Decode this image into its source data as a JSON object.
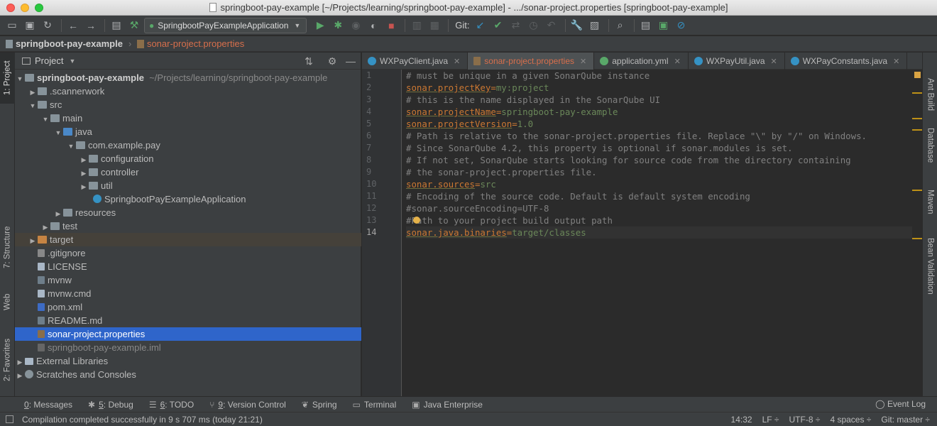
{
  "window": {
    "title": "springboot-pay-example [~/Projects/learning/springboot-pay-example] - .../sonar-project.properties [springboot-pay-example]"
  },
  "toolbar": {
    "run_config": "SpringbootPayExampleApplication",
    "git_label": "Git:"
  },
  "breadcrumb": {
    "root": "springboot-pay-example",
    "file": "sonar-project.properties"
  },
  "left_stripe": {
    "project_tab": "1: Project",
    "structure_tab": "7: Structure",
    "web_tab": "Web",
    "favorites_tab": "2: Favorites"
  },
  "right_stripe": {
    "ant": "Ant Build",
    "database": "Database",
    "maven": "Maven",
    "bean": "Bean Validation"
  },
  "project_panel": {
    "title": "Project",
    "tree": [
      {
        "label": "springboot-pay-example",
        "extra": "~/Projects/learning/springboot-pay-example"
      },
      {
        "label": ".scannerwork"
      },
      {
        "label": "src"
      },
      {
        "label": "main"
      },
      {
        "label": "java"
      },
      {
        "label": "com.example.pay"
      },
      {
        "label": "configuration"
      },
      {
        "label": "controller"
      },
      {
        "label": "util"
      },
      {
        "label": "SpringbootPayExampleApplication"
      },
      {
        "label": "resources"
      },
      {
        "label": "test"
      },
      {
        "label": "target"
      },
      {
        "label": ".gitignore"
      },
      {
        "label": "LICENSE"
      },
      {
        "label": "mvnw"
      },
      {
        "label": "mvnw.cmd"
      },
      {
        "label": "pom.xml"
      },
      {
        "label": "README.md"
      },
      {
        "label": "sonar-project.properties"
      },
      {
        "label": "springboot-pay-example.iml"
      },
      {
        "label": "External Libraries"
      },
      {
        "label": "Scratches and Consoles"
      }
    ]
  },
  "tabs": [
    {
      "label": "WXPayClient.java"
    },
    {
      "label": "sonar-project.properties"
    },
    {
      "label": "application.yml"
    },
    {
      "label": "WXPayUtil.java"
    },
    {
      "label": "WXPayConstants.java"
    }
  ],
  "editor": {
    "line_numbers": [
      "1",
      "2",
      "3",
      "4",
      "5",
      "6",
      "7",
      "8",
      "9",
      "10",
      "11",
      "12",
      "13",
      "14"
    ],
    "lines": [
      {
        "comment": "# must be unique in a given SonarQube instance"
      },
      {
        "key": "sonar.projectKey",
        "eq": "=",
        "value": "my:project"
      },
      {
        "comment": "# this is the name displayed in the SonarQube UI"
      },
      {
        "key": "sonar.projectName",
        "eq": "=",
        "value": "springboot-pay-example"
      },
      {
        "key": "sonar.projectVersion",
        "eq": "=",
        "value": "1.0"
      },
      {
        "comment": "# Path is relative to the sonar-project.properties file. Replace \"\\\" by \"/\" on Windows."
      },
      {
        "comment": "# Since SonarQube 4.2, this property is optional if sonar.modules is set."
      },
      {
        "comment": "# If not set, SonarQube starts looking for source code from the directory containing"
      },
      {
        "comment": "# the sonar-project.properties file."
      },
      {
        "key": "sonar.sources",
        "eq": "=",
        "value": "src"
      },
      {
        "comment": "# Encoding of the source code. Default is default system encoding"
      },
      {
        "comment": "#sonar.sourceEncoding=UTF-8"
      },
      {
        "comment": "#Path to your project build output path"
      },
      {
        "key": "sonar.java.binaries",
        "eq": "=",
        "value": "target/classes"
      }
    ]
  },
  "bottom_tools": [
    {
      "num": "0",
      "rest": ": Messages"
    },
    {
      "num": "5",
      "rest": ": Debug"
    },
    {
      "num": "6",
      "rest": ": TODO"
    },
    {
      "num": "9",
      "rest": ": Version Control"
    },
    {
      "num": "",
      "rest": "Spring"
    },
    {
      "num": "",
      "rest": "Terminal"
    },
    {
      "num": "",
      "rest": "Java Enterprise"
    }
  ],
  "event_log": "Event Log",
  "status": {
    "message": "Compilation completed successfully in 9 s 707 ms (today 21:21)",
    "position": "14:32",
    "line_sep": "LF ÷",
    "encoding": "UTF-8 ÷",
    "indent": "4 spaces ÷",
    "git": "Git: master ÷"
  }
}
